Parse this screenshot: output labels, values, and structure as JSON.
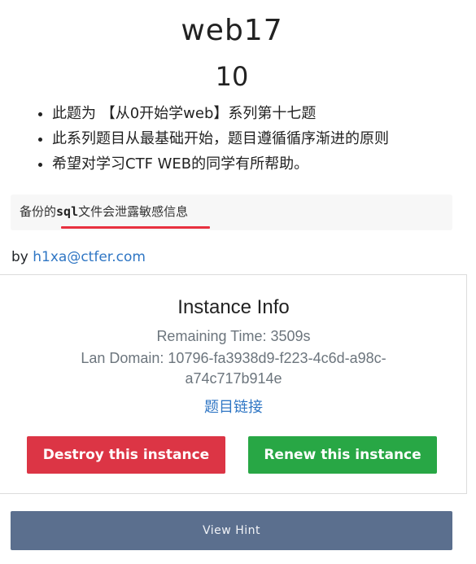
{
  "challenge": {
    "name": "web17",
    "value": "10",
    "description": [
      "此题为 【从0开始学web】系列第十七题",
      "此系列题目从最基础开始，题目遵循循序渐进的原则",
      "希望对学习CTF WEB的同学有所帮助。"
    ],
    "hint": {
      "prefix": "备份的",
      "code": "sql",
      "suffix": "文件会泄露敏感信息"
    },
    "author": {
      "by": "by ",
      "email": "h1xa@ctfer.com"
    }
  },
  "instance": {
    "title": "Instance Info",
    "remaining_time": "Remaining Time: 3509s",
    "lan_domain_line1": "Lan Domain: 10796-fa3938d9-f223-4c6d-a98c-",
    "lan_domain_line2": "a74c717b914e",
    "link_label": "题目链接",
    "destroy_label": "Destroy this instance",
    "renew_label": "Renew this instance"
  },
  "footer": {
    "view_hint_label": "View Hint"
  },
  "colors": {
    "destroy": "#dc3545",
    "renew": "#28a745",
    "view_hint": "#5b6f8e",
    "link": "#2f76c4",
    "highlight_underline": "#e8303f"
  }
}
